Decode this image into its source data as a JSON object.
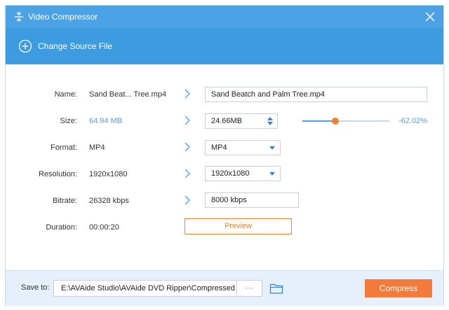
{
  "window": {
    "title": "Video Compressor"
  },
  "toolbar": {
    "change_source_label": "Change Source File"
  },
  "fields": {
    "name": {
      "label": "Name:",
      "original": "Sand Beat... Tree.mp4",
      "value": "Sand Beatch and Palm Tree.mp4"
    },
    "size": {
      "label": "Size:",
      "original": "64.94 MB",
      "value": "24.66MB",
      "percent": "-62.02%",
      "slider_fraction": 0.38
    },
    "format": {
      "label": "Format:",
      "original": "MP4",
      "value": "MP4"
    },
    "resolution": {
      "label": "Resolution:",
      "original": "1920x1080",
      "value": "1920x1080"
    },
    "bitrate": {
      "label": "Bitrate:",
      "original": "26328 kbps",
      "value": "8000 kbps"
    },
    "duration": {
      "label": "Duration:",
      "original": "00:00:20"
    }
  },
  "preview": {
    "label": "Preview"
  },
  "footer": {
    "save_label": "Save to:",
    "path": "E:\\AVAide Studio\\AVAide DVD Ripper\\Compressed",
    "browse_label": "···",
    "compress_label": "Compress"
  },
  "colors": {
    "accent": "#4ba3e6",
    "orange": "#f37a3a"
  }
}
